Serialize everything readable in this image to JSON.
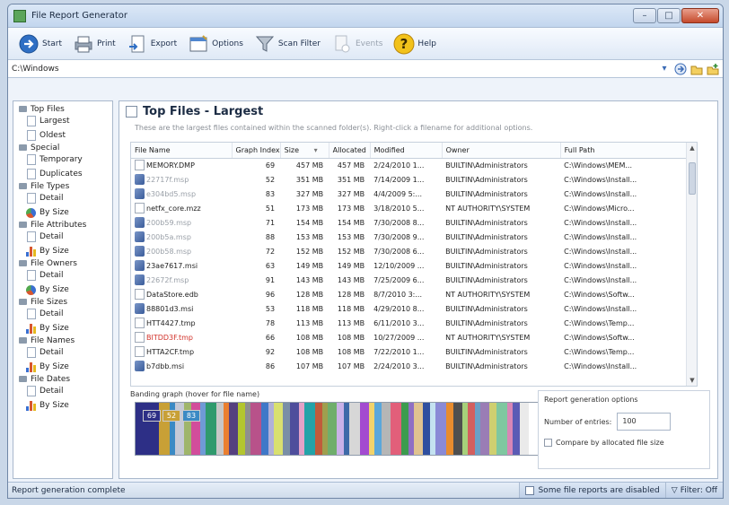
{
  "window": {
    "title": "File Report Generator"
  },
  "toolbar": {
    "start": "Start",
    "print": "Print",
    "export": "Export",
    "options": "Options",
    "scan_filter": "Scan Filter",
    "events": "Events",
    "help": "Help"
  },
  "address": {
    "path": "C:\\Windows"
  },
  "sidebar": {
    "categories": [
      {
        "label": "Top Files",
        "items": [
          "Largest",
          "Oldest"
        ]
      },
      {
        "label": "Special",
        "items": [
          "Temporary",
          "Duplicates"
        ]
      },
      {
        "label": "File Types",
        "items": [
          "Detail",
          "By Size"
        ]
      },
      {
        "label": "File Attributes",
        "items": [
          "Detail",
          "By Size"
        ]
      },
      {
        "label": "File Owners",
        "items": [
          "Detail",
          "By Size"
        ]
      },
      {
        "label": "File Sizes",
        "items": [
          "Detail",
          "By Size"
        ]
      },
      {
        "label": "File Names",
        "items": [
          "Detail",
          "By Size"
        ]
      },
      {
        "label": "File Dates",
        "items": [
          "Detail",
          "By Size"
        ]
      }
    ]
  },
  "main": {
    "title": "Top Files - Largest",
    "description": "These are the largest files contained within the scanned folder(s). Right-click a filename for additional options."
  },
  "table": {
    "columns": [
      "File Name",
      "Graph Index",
      "Size",
      "Allocated",
      "Modified",
      "Owner",
      "Full Path"
    ],
    "rows": [
      {
        "name": "MEMORY.DMP",
        "index": "69",
        "size": "457 MB",
        "alloc": "457 MB",
        "modified": "2/24/2010 1...",
        "owner": "BUILTIN\\Administrators",
        "path": "C:\\Windows\\MEM...",
        "style": "normal",
        "icon": "doc"
      },
      {
        "name": "22717f.msp",
        "index": "52",
        "size": "351 MB",
        "alloc": "351 MB",
        "modified": "7/14/2009 1...",
        "owner": "BUILTIN\\Administrators",
        "path": "C:\\Windows\\Install...",
        "style": "gray",
        "icon": "pkg"
      },
      {
        "name": "e304bd5.msp",
        "index": "83",
        "size": "327 MB",
        "alloc": "327 MB",
        "modified": "4/4/2009 5:...",
        "owner": "BUILTIN\\Administrators",
        "path": "C:\\Windows\\Install...",
        "style": "gray",
        "icon": "pkg"
      },
      {
        "name": "netfx_core.mzz",
        "index": "51",
        "size": "173 MB",
        "alloc": "173 MB",
        "modified": "3/18/2010 5...",
        "owner": "NT AUTHORITY\\SYSTEM",
        "path": "C:\\Windows\\Micro...",
        "style": "normal",
        "icon": "doc"
      },
      {
        "name": "200b59.msp",
        "index": "71",
        "size": "154 MB",
        "alloc": "154 MB",
        "modified": "7/30/2008 8...",
        "owner": "BUILTIN\\Administrators",
        "path": "C:\\Windows\\Install...",
        "style": "gray",
        "icon": "pkg"
      },
      {
        "name": "200b5a.msp",
        "index": "88",
        "size": "153 MB",
        "alloc": "153 MB",
        "modified": "7/30/2008 9...",
        "owner": "BUILTIN\\Administrators",
        "path": "C:\\Windows\\Install...",
        "style": "gray",
        "icon": "pkg"
      },
      {
        "name": "200b58.msp",
        "index": "72",
        "size": "152 MB",
        "alloc": "152 MB",
        "modified": "7/30/2008 6...",
        "owner": "BUILTIN\\Administrators",
        "path": "C:\\Windows\\Install...",
        "style": "gray",
        "icon": "pkg"
      },
      {
        "name": "23ae7617.msi",
        "index": "63",
        "size": "149 MB",
        "alloc": "149 MB",
        "modified": "12/10/2009 ...",
        "owner": "BUILTIN\\Administrators",
        "path": "C:\\Windows\\Install...",
        "style": "normal",
        "icon": "pkg"
      },
      {
        "name": "22672f.msp",
        "index": "91",
        "size": "143 MB",
        "alloc": "143 MB",
        "modified": "7/25/2009 6...",
        "owner": "BUILTIN\\Administrators",
        "path": "C:\\Windows\\Install...",
        "style": "gray",
        "icon": "pkg"
      },
      {
        "name": "DataStore.edb",
        "index": "96",
        "size": "128 MB",
        "alloc": "128 MB",
        "modified": "8/7/2010 3:...",
        "owner": "NT AUTHORITY\\SYSTEM",
        "path": "C:\\Windows\\Softw...",
        "style": "normal",
        "icon": "doc"
      },
      {
        "name": "88801d3.msi",
        "index": "53",
        "size": "118 MB",
        "alloc": "118 MB",
        "modified": "4/29/2010 8...",
        "owner": "BUILTIN\\Administrators",
        "path": "C:\\Windows\\Install...",
        "style": "normal",
        "icon": "pkg"
      },
      {
        "name": "HTT4427.tmp",
        "index": "78",
        "size": "113 MB",
        "alloc": "113 MB",
        "modified": "6/11/2010 3...",
        "owner": "BUILTIN\\Administrators",
        "path": "C:\\Windows\\Temp...",
        "style": "normal",
        "icon": "doc"
      },
      {
        "name": "BITDD3F.tmp",
        "index": "66",
        "size": "108 MB",
        "alloc": "108 MB",
        "modified": "10/27/2009 ...",
        "owner": "NT AUTHORITY\\SYSTEM",
        "path": "C:\\Windows\\Softw...",
        "style": "red",
        "icon": "doc"
      },
      {
        "name": "HTTA2CF.tmp",
        "index": "92",
        "size": "108 MB",
        "alloc": "108 MB",
        "modified": "7/22/2010 1...",
        "owner": "BUILTIN\\Administrators",
        "path": "C:\\Windows\\Temp...",
        "style": "normal",
        "icon": "doc"
      },
      {
        "name": "b7dbb.msi",
        "index": "86",
        "size": "107 MB",
        "alloc": "107 MB",
        "modified": "2/24/2010 3...",
        "owner": "BUILTIN\\Administrators",
        "path": "C:\\Windows\\Install...",
        "style": "normal",
        "icon": "pkg"
      }
    ]
  },
  "banding": {
    "label": "Banding graph (hover for file name)",
    "boxes": [
      "69",
      "52",
      "83"
    ],
    "colors": [
      "#2d2f86",
      "#2d2f86",
      "#c8a036",
      "#3b8ac4",
      "#c5c9d6",
      "#9fb56b",
      "#d24d9b",
      "#6f9ad6",
      "#2f9a6d",
      "#c7c7c7",
      "#ea7f2f",
      "#55407f",
      "#b3c62f",
      "#8f8f8f",
      "#b8528a",
      "#3f78c8",
      "#b1b1d8",
      "#d9e06f",
      "#7a8fa6",
      "#4e4e9c",
      "#e3a2c7",
      "#23a3a8",
      "#c05b3b",
      "#9f9f4e",
      "#6fae6c",
      "#c9b2e8",
      "#3e6aa8",
      "#d7d7d7",
      "#a34bd0",
      "#f1d36b",
      "#5aa7db",
      "#b6b6b6",
      "#e25f7a",
      "#3c9c4e",
      "#8f6fc4",
      "#e0c390",
      "#2f4f9f",
      "#c4e2f0",
      "#8a8ad6",
      "#e88c2e",
      "#4f4f4f",
      "#a6d07a",
      "#d35f5f",
      "#6aa0c7",
      "#9a7db5",
      "#cfcf70",
      "#7fc7a0",
      "#d886b6",
      "#5b5bb5",
      "#eaeaea"
    ]
  },
  "options": {
    "title": "Report generation options",
    "entries_label": "Number of entries:",
    "entries_value": "100",
    "compare_label": "Compare by allocated file size"
  },
  "status": {
    "text": "Report generation complete",
    "disabled_text": "Some file reports are disabled",
    "filter_text": "Filter: Off"
  }
}
